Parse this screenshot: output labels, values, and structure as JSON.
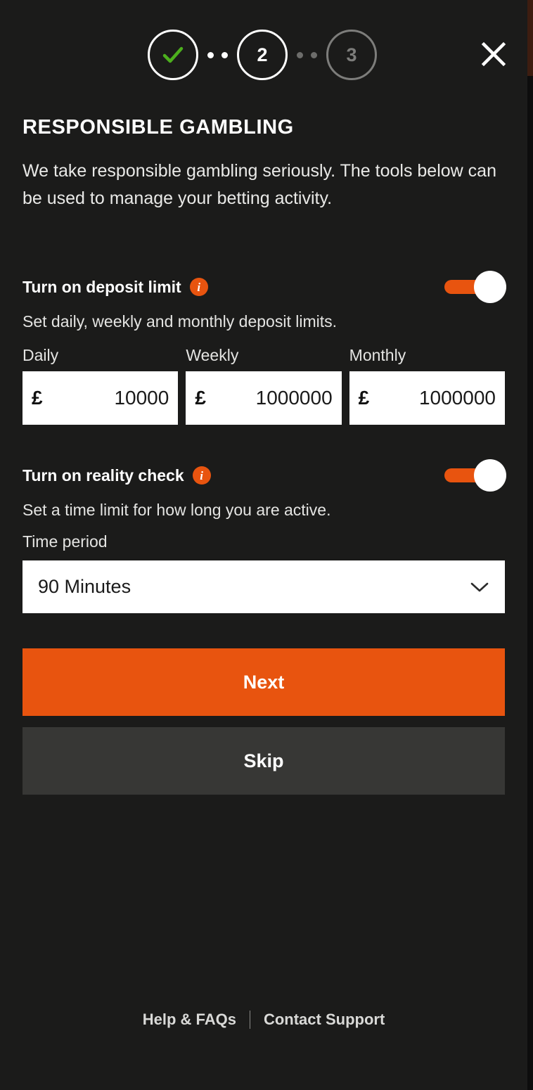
{
  "stepper": {
    "steps": [
      {
        "id": "step-1",
        "label": "",
        "state": "done",
        "icon": "check-icon"
      },
      {
        "id": "step-2",
        "label": "2",
        "state": "active",
        "icon": ""
      },
      {
        "id": "step-3",
        "label": "3",
        "state": "todo",
        "icon": ""
      }
    ]
  },
  "close": {
    "icon": "close-icon"
  },
  "header": {
    "title": "RESPONSIBLE GAMBLING",
    "intro": "We take responsible gambling seriously. The tools below can be used to manage your betting activity."
  },
  "deposit_limit": {
    "title": "Turn on deposit limit",
    "info_icon": "info-icon",
    "toggle_state": "on",
    "description": "Set daily, weekly and monthly deposit limits.",
    "currency_symbol": "£",
    "fields": [
      {
        "label": "Daily",
        "value": "10000",
        "placeholder": "0"
      },
      {
        "label": "Weekly",
        "value": "1000000",
        "placeholder": "0"
      },
      {
        "label": "Monthly",
        "value": "1000000",
        "placeholder": "0"
      }
    ]
  },
  "reality_check": {
    "title": "Turn on reality check",
    "info_icon": "info-icon",
    "toggle_state": "on",
    "description": "Set a time limit for how long you are active.",
    "select_label": "Time period",
    "select_value": "90 Minutes",
    "chevron_icon": "chevron-down-icon"
  },
  "actions": {
    "next_label": "Next",
    "skip_label": "Skip"
  },
  "footer": {
    "help_label": "Help & FAQs",
    "contact_label": "Contact Support"
  },
  "colors": {
    "background": "#1b1b1a",
    "accent_orange": "#e8540f",
    "check_green": "#4caf1d",
    "skip_gray": "#373735",
    "inactive_gray": "#7d7d7b",
    "edge_strip": "#3d1d10"
  }
}
